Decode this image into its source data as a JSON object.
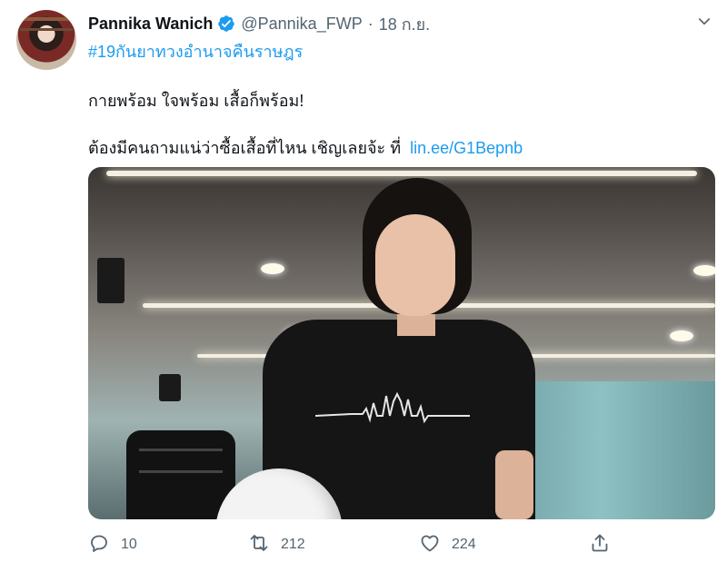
{
  "tweet": {
    "display_name": "Pannika Wanich",
    "handle": "@Pannika_FWP",
    "separator": "·",
    "date": "18 ก.ย.",
    "hashtag": "#19กันยาทวงอำนาจคืนราษฎร",
    "line1": "กายพร้อม ใจพร้อม เสื้อก็พร้อม!",
    "line2": "ต้องมีคนถามแน่ว่าซื้อเสื้อที่ไหน เชิญเลยจ้ะ ที่",
    "link": "lin.ee/G1Bepnb"
  },
  "actions": {
    "reply_count": "10",
    "retweet_count": "212",
    "like_count": "224"
  },
  "icons": {
    "verified": "verified-badge-icon",
    "menu": "chevron-down-icon",
    "reply": "reply-icon",
    "retweet": "retweet-icon",
    "like": "heart-icon",
    "share": "share-icon"
  },
  "colors": {
    "accent": "#1d9bf0",
    "text": "#0f1419",
    "secondary": "#536471"
  }
}
